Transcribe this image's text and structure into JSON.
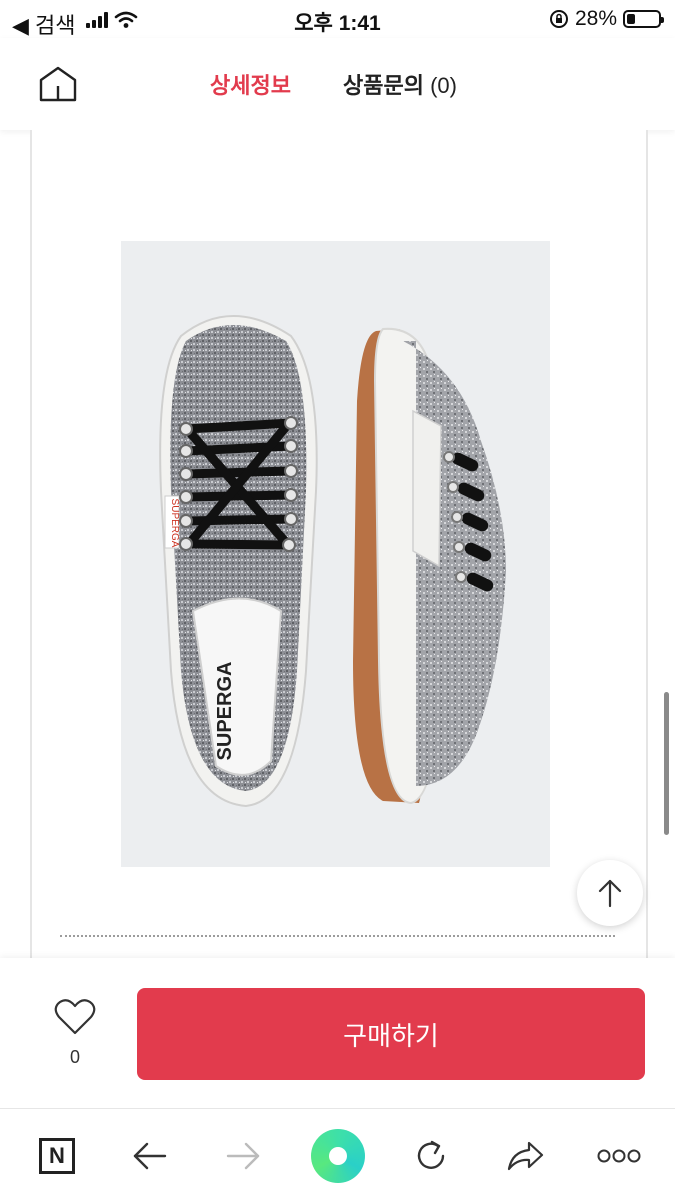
{
  "status_bar": {
    "back_label": "◀ 검색",
    "time": "오후 1:41",
    "battery": "28%",
    "battery_level": 0.28
  },
  "header": {
    "tabs": [
      {
        "label": "상세정보",
        "active": true
      },
      {
        "label": "상품문의",
        "count": "(0)",
        "active": false
      }
    ]
  },
  "product_image": {
    "brand_text": "SUPERGA"
  },
  "purchase": {
    "like_count": "0",
    "buy_label": "구매하기"
  },
  "browser_toolbar": {
    "n_label": "N"
  },
  "colors": {
    "accent": "#e23b4d",
    "toolbar_green": "#3ee0a8"
  }
}
